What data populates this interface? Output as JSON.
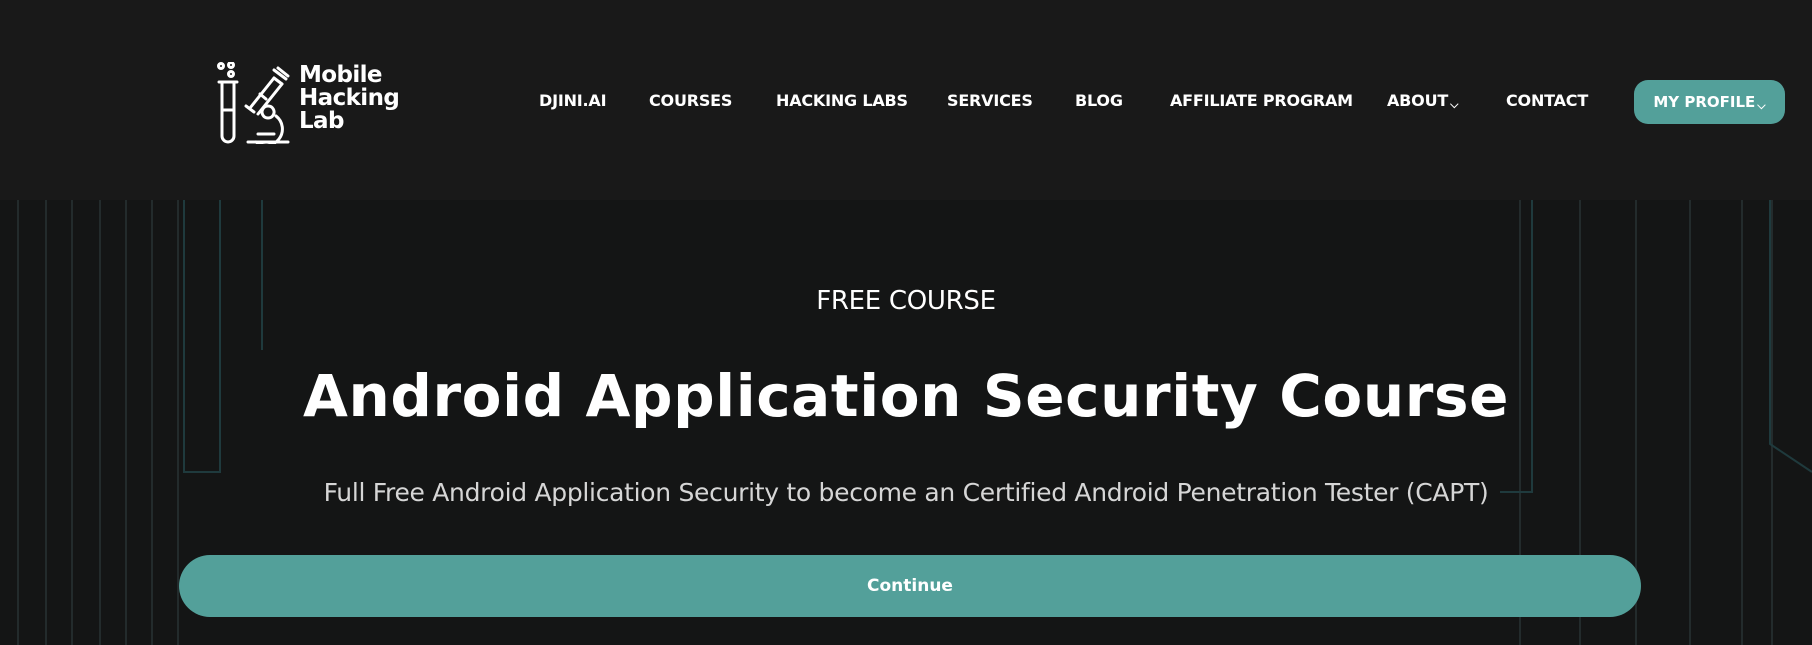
{
  "brand": {
    "logo_lines": [
      "Mobile",
      "Hacking",
      "Lab"
    ],
    "logo_icon": "microscope-test-tube-icon"
  },
  "nav": {
    "items": [
      {
        "label": "DJINI.AI"
      },
      {
        "label": "COURSES"
      },
      {
        "label": "HACKING LABS"
      },
      {
        "label": "SERVICES"
      },
      {
        "label": "BLOG"
      },
      {
        "label": "AFFILIATE PROGRAM"
      },
      {
        "label": "ABOUT",
        "dropdown_icon": "chevron-down-icon"
      },
      {
        "label": "CONTACT"
      }
    ],
    "profile": {
      "label": "MY PROFILE",
      "dropdown_icon": "chevron-down-icon"
    }
  },
  "hero": {
    "eyebrow": "FREE COURSE",
    "title": "Android Application Security Course",
    "subtitle": "Full Free Android Application Security to become an Certified Android Penetration Tester (CAPT)",
    "cta_label": "Continue"
  },
  "colors": {
    "header_bg": "#191919",
    "hero_bg": "#141515",
    "accent": "#53a09a",
    "text": "#ffffff",
    "subtitle_text": "#d6d6d6"
  }
}
